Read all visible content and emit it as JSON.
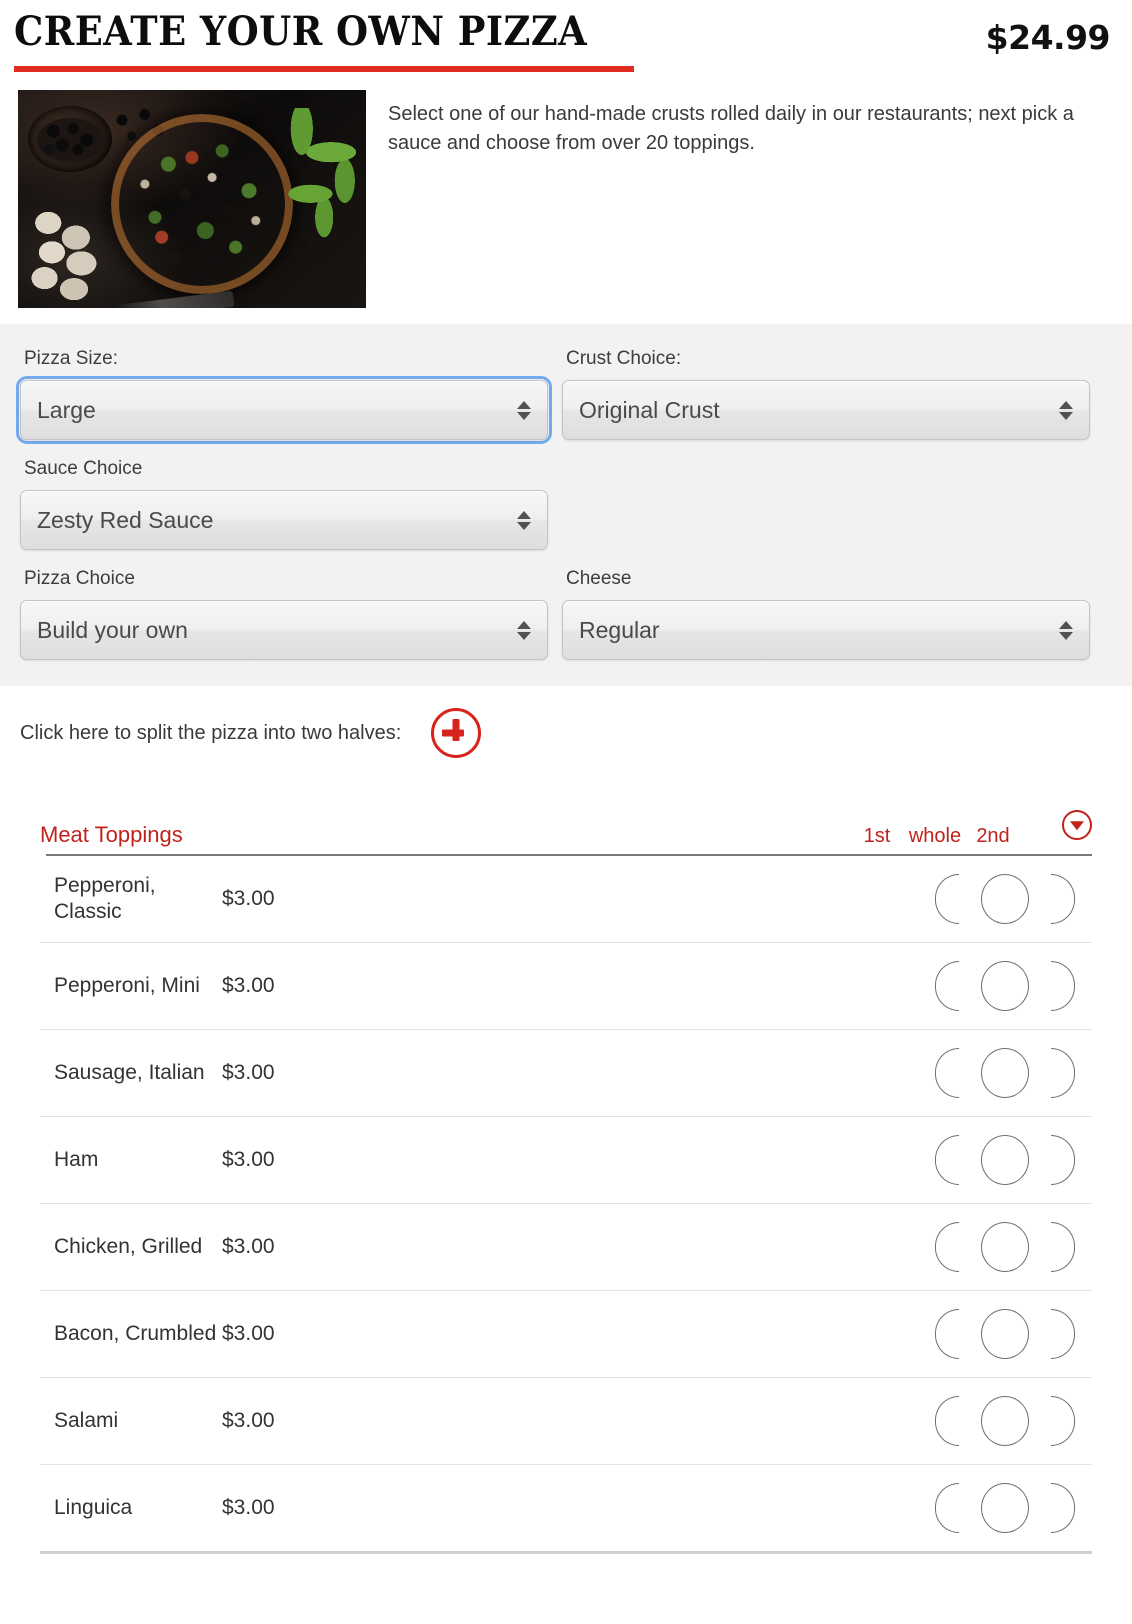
{
  "header": {
    "title": "CREATE YOUR OWN PIZZA",
    "price": "$24.99"
  },
  "intro": {
    "description": "Select one of our hand-made crusts rolled daily in our restaurants; next pick a sauce and choose from over 20 toppings.",
    "photo_alt": "pizza-photo"
  },
  "options": {
    "pizza_size": {
      "label": "Pizza Size:",
      "value": "Large"
    },
    "crust_choice": {
      "label": "Crust Choice:",
      "value": "Original Crust"
    },
    "sauce_choice": {
      "label": "Sauce Choice",
      "value": "Zesty Red Sauce"
    },
    "pizza_choice": {
      "label": "Pizza Choice",
      "value": "Build your own"
    },
    "cheese": {
      "label": "Cheese",
      "value": "Regular"
    }
  },
  "split": {
    "label": "Click here to split the pizza into two halves:",
    "icon": "plus-circle-icon"
  },
  "toppings_section": {
    "title": "Meat Toppings",
    "collapse_icon": "chevron-down-circle-icon",
    "columns": [
      "1st",
      "whole",
      "2nd"
    ],
    "accent_color": "#c0231c",
    "items": [
      {
        "name": "Pepperoni, Classic",
        "price": "$3.00"
      },
      {
        "name": "Pepperoni, Mini",
        "price": "$3.00"
      },
      {
        "name": "Sausage, Italian",
        "price": "$3.00"
      },
      {
        "name": "Ham",
        "price": "$3.00"
      },
      {
        "name": "Chicken, Grilled",
        "price": "$3.00"
      },
      {
        "name": "Bacon, Crumbled",
        "price": "$3.00"
      },
      {
        "name": "Salami",
        "price": "$3.00"
      },
      {
        "name": "Linguica",
        "price": "$3.00"
      }
    ]
  }
}
